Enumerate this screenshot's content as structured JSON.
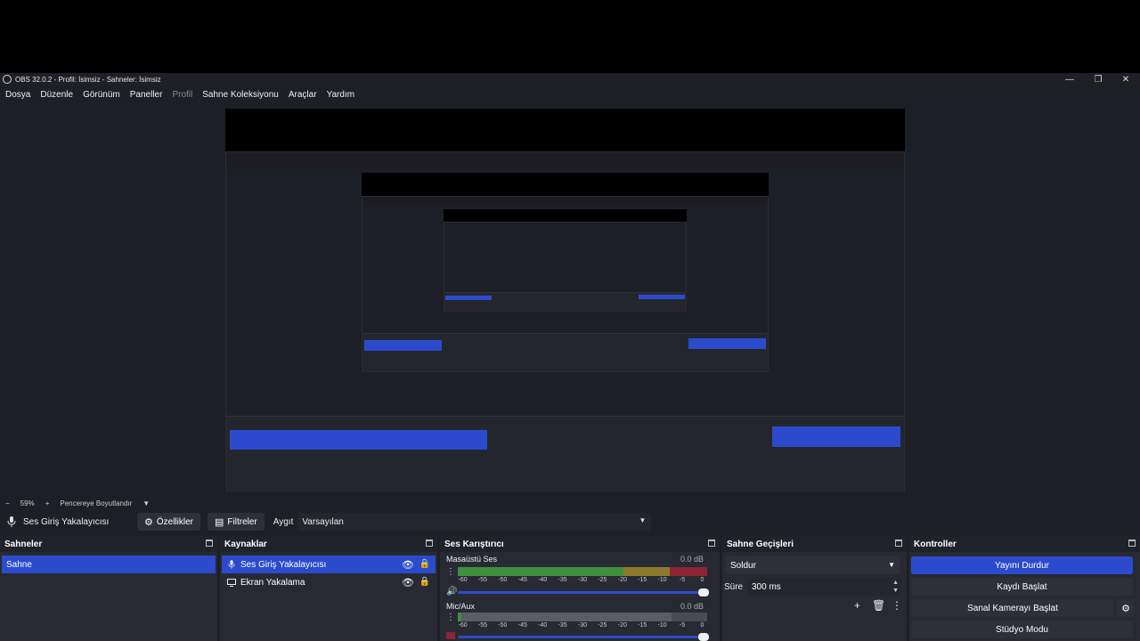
{
  "window": {
    "title": "OBS 32.0.2 - Profil: İsimsiz - Sahneler: İsimsiz"
  },
  "menu": [
    "Dosya",
    "Düzenle",
    "Görünüm",
    "Paneller",
    "Profil",
    "Sahne Koleksiyonu",
    "Araçlar",
    "Yardım"
  ],
  "zoom": {
    "minus": "−",
    "level": "59%",
    "plus": "+",
    "fit_label": "Pencereye Boyutlandır"
  },
  "context_bar": {
    "source_name": "Ses Giriş Yakalayıcısı",
    "properties_label": "Özellikler",
    "filters_label": "Filtreler",
    "device_label": "Aygıt",
    "device_value": "Varsayılan"
  },
  "docks": {
    "scenes": {
      "title": "Sahneler",
      "items": [
        "Sahne"
      ]
    },
    "sources": {
      "title": "Kaynaklar",
      "items": [
        {
          "label": "Ses Giriş Yakalayıcısı",
          "icon": "microphone-icon"
        },
        {
          "label": "Ekran Yakalama",
          "icon": "monitor-icon"
        }
      ]
    },
    "mixer": {
      "title": "Ses Karıştırıcı",
      "tracks": [
        {
          "name": "Masaüstü Ses",
          "db": "0.0 dB"
        },
        {
          "name": "Mic/Aux",
          "db": "0.0 dB"
        }
      ],
      "ticks": [
        "-60",
        "-55",
        "-50",
        "-45",
        "-40",
        "-35",
        "-30",
        "-25",
        "-20",
        "-15",
        "-10",
        "-5",
        "0"
      ]
    },
    "transitions": {
      "title": "Sahne Geçişleri",
      "selected": "Soldur",
      "duration_label": "Süre",
      "duration_value": "300 ms"
    },
    "controls": {
      "title": "Kontroller",
      "stop_stream": "Yayını Durdur",
      "start_record": "Kaydı Başlat",
      "start_virtualcam": "Sanal Kamerayı Başlat",
      "studio_mode": "Stüdyo Modu"
    }
  },
  "colors": {
    "accent": "#2c4bcc",
    "background": "#1d1f26",
    "dock": "#272a33",
    "meter_green": "#3a8a3a",
    "meter_yellow": "#8a7a2e",
    "meter_red": "#8a2230"
  }
}
